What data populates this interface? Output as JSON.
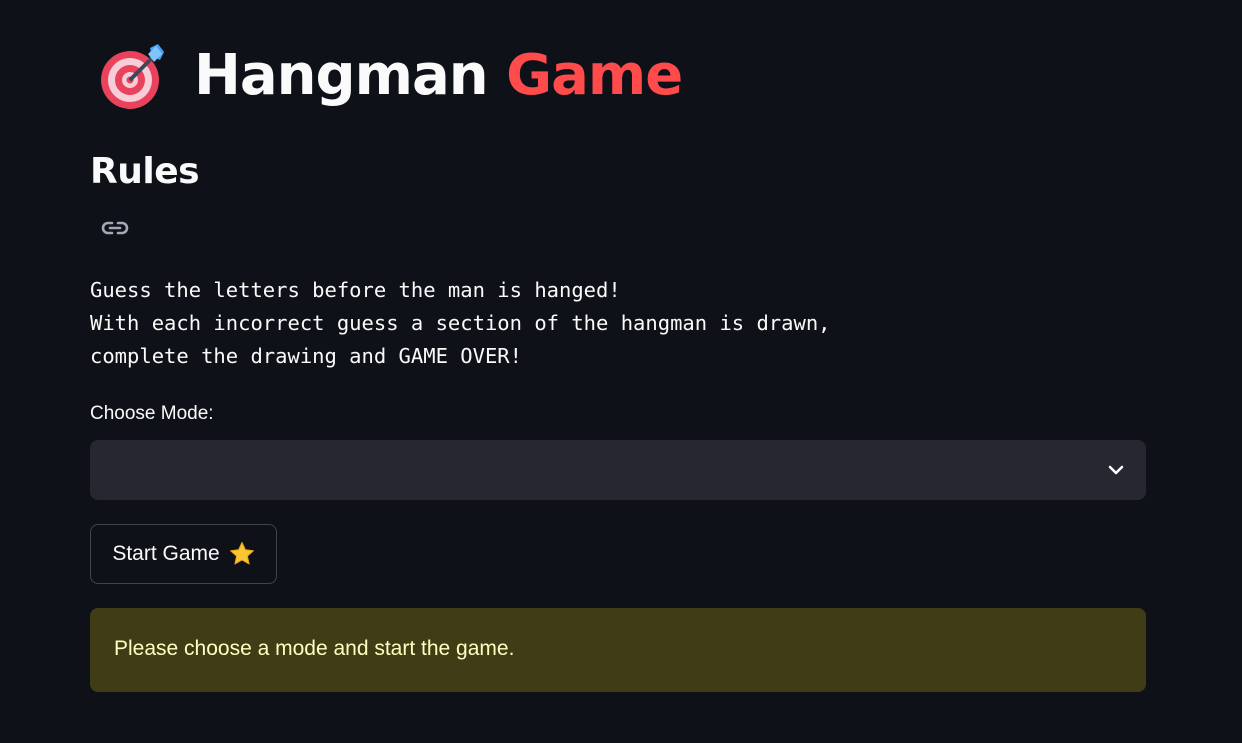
{
  "title": {
    "icon": "dart-target-icon",
    "main": "Hangman",
    "accent": "Game",
    "accent_color": "#ff4b4b"
  },
  "rules": {
    "heading": "Rules",
    "anchor_icon": "link-icon",
    "lines": [
      "Guess the letters before the man is hanged!",
      "With each incorrect guess a section of the hangman is drawn,",
      "complete the drawing and GAME OVER!"
    ]
  },
  "mode": {
    "label": "Choose Mode:",
    "selected": "",
    "dropdown_icon": "chevron-down-icon"
  },
  "start_button": {
    "label": "Start Game",
    "icon": "star-icon"
  },
  "alert": {
    "message": "Please choose a mode and start the game.",
    "background": "#403d16",
    "text_color": "#ffffc2"
  },
  "colors": {
    "background": "#0e1117",
    "select_background": "#262730",
    "text": "#fafafa"
  }
}
